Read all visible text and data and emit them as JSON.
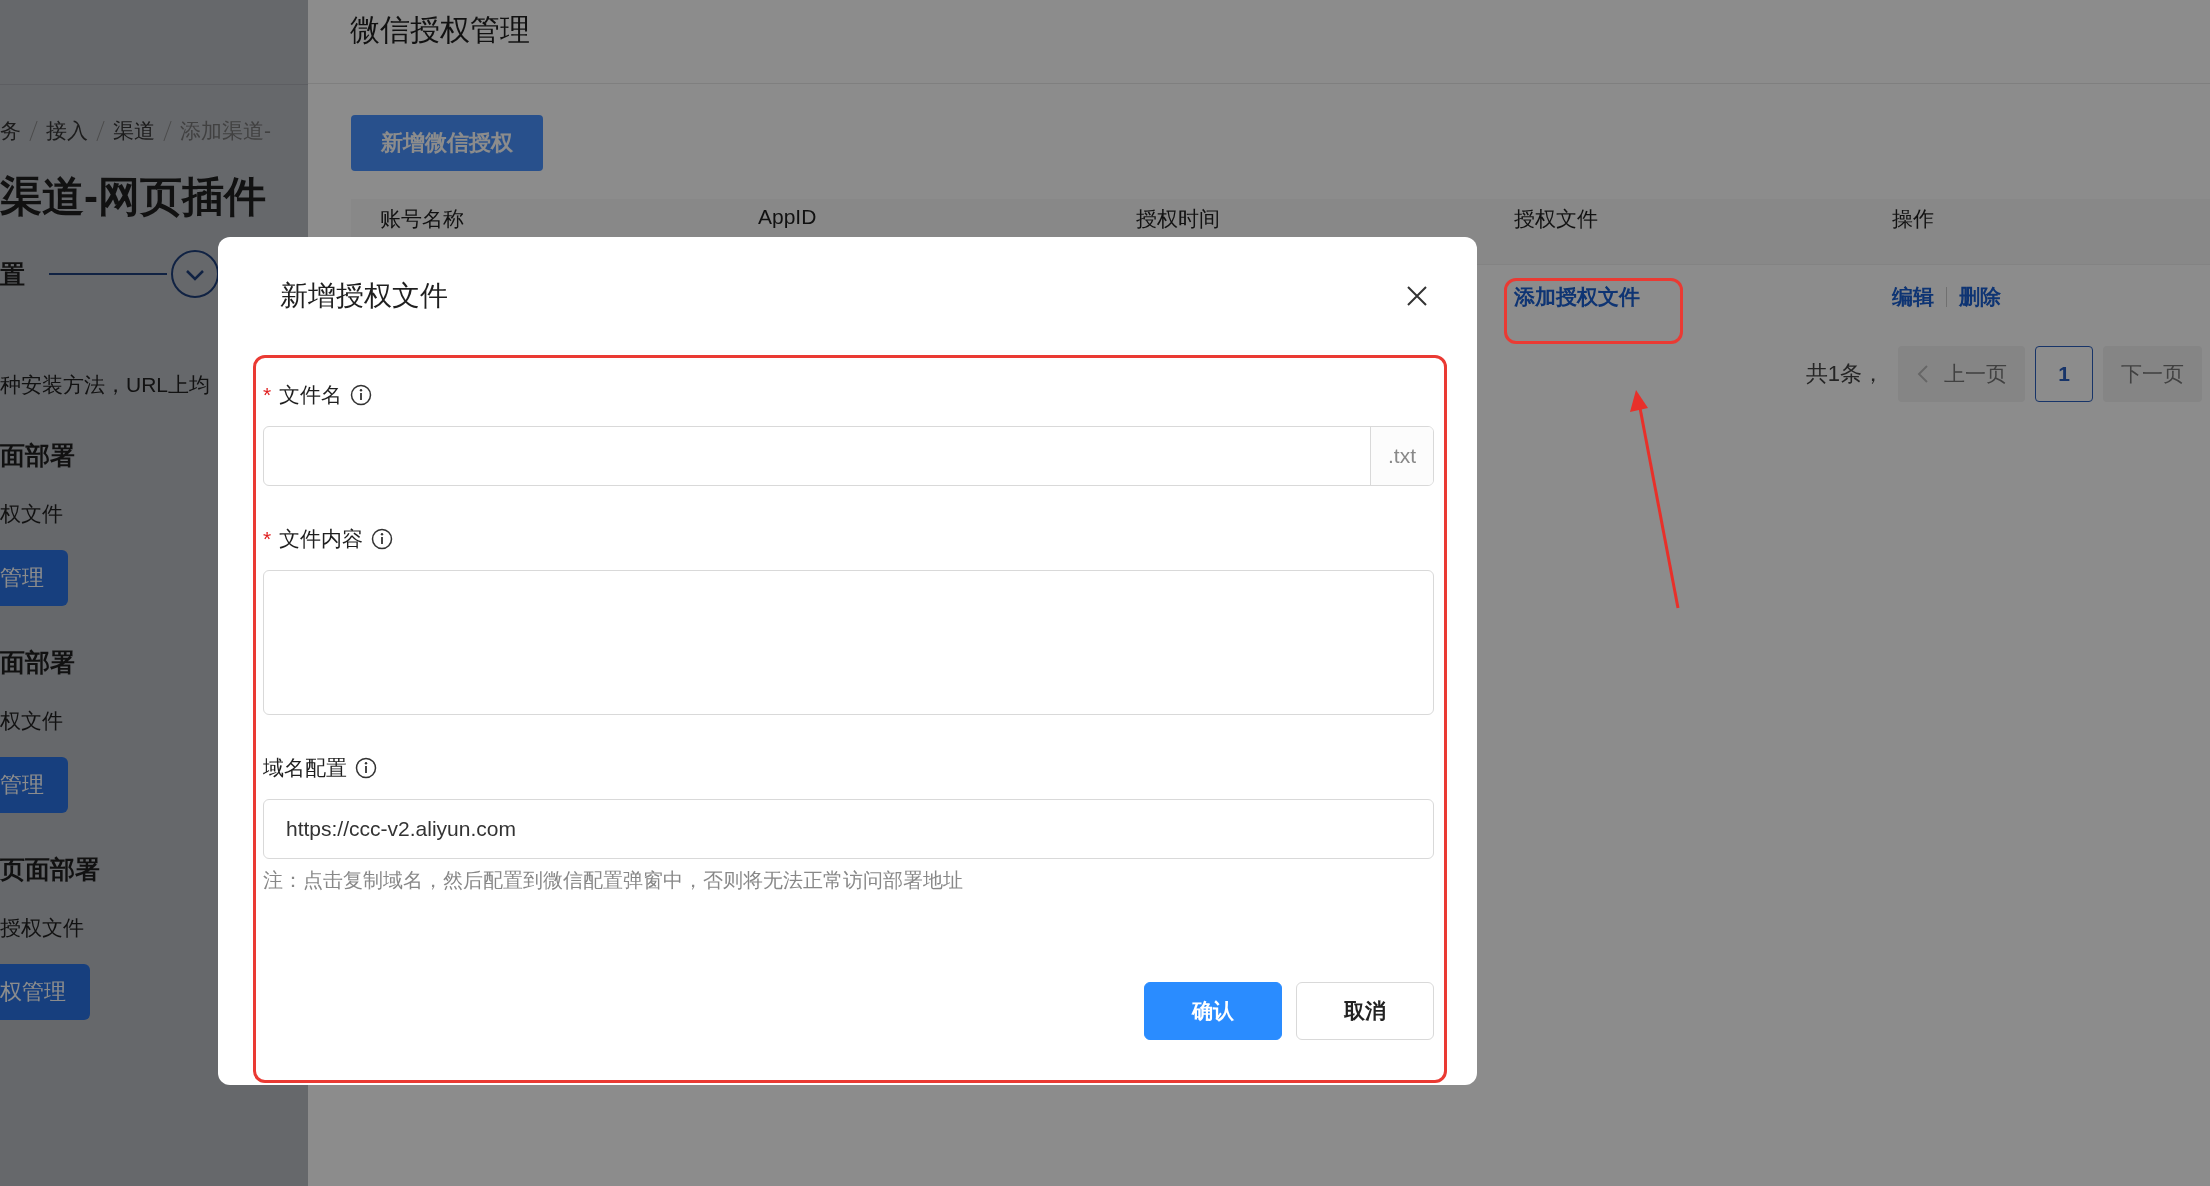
{
  "side_panel": {
    "breadcrumb": [
      "务",
      "接入",
      "渠道",
      "添加渠道-"
    ],
    "title": "渠道-网页插件",
    "step": {
      "label": "置"
    },
    "description": "种安装方法，URL上均",
    "sections": [
      {
        "heading": "面部署",
        "label": "权文件",
        "button": "管理"
      },
      {
        "heading": "面部署",
        "label": "权文件",
        "button": "管理"
      },
      {
        "heading": "页面部署",
        "label": "授权文件",
        "button": "权管理"
      }
    ]
  },
  "page": {
    "title": "微信授权管理",
    "add_button": "新增微信授权",
    "table": {
      "columns": [
        "账号名称",
        "AppID",
        "授权时间",
        "授权文件",
        "操作"
      ],
      "rows": [
        {
          "file_link": "添加授权文件",
          "actions": [
            "编辑",
            "删除"
          ]
        }
      ]
    },
    "pagination": {
      "total": "共1条，",
      "prev": "上一页",
      "pages": [
        {
          "label": "1",
          "selected": true
        }
      ],
      "next": "下一页"
    }
  },
  "dialog": {
    "title": "新增授权文件",
    "fields": [
      {
        "kind": "input",
        "marker": "*",
        "label": "文件名",
        "suffix": ".txt"
      },
      {
        "kind": "textarea",
        "marker": "*",
        "label": "文件内容"
      },
      {
        "kind": "input",
        "label": "域名配置",
        "value": "https://ccc-v2.aliyun.com",
        "note": "注：点击复制域名，然后配置到微信配置弹窗中，否则将无法正常访问部署地址"
      }
    ],
    "buttons": [
      {
        "kind": "primary",
        "label": "确认"
      },
      {
        "kind": "default",
        "label": "取消"
      }
    ]
  }
}
